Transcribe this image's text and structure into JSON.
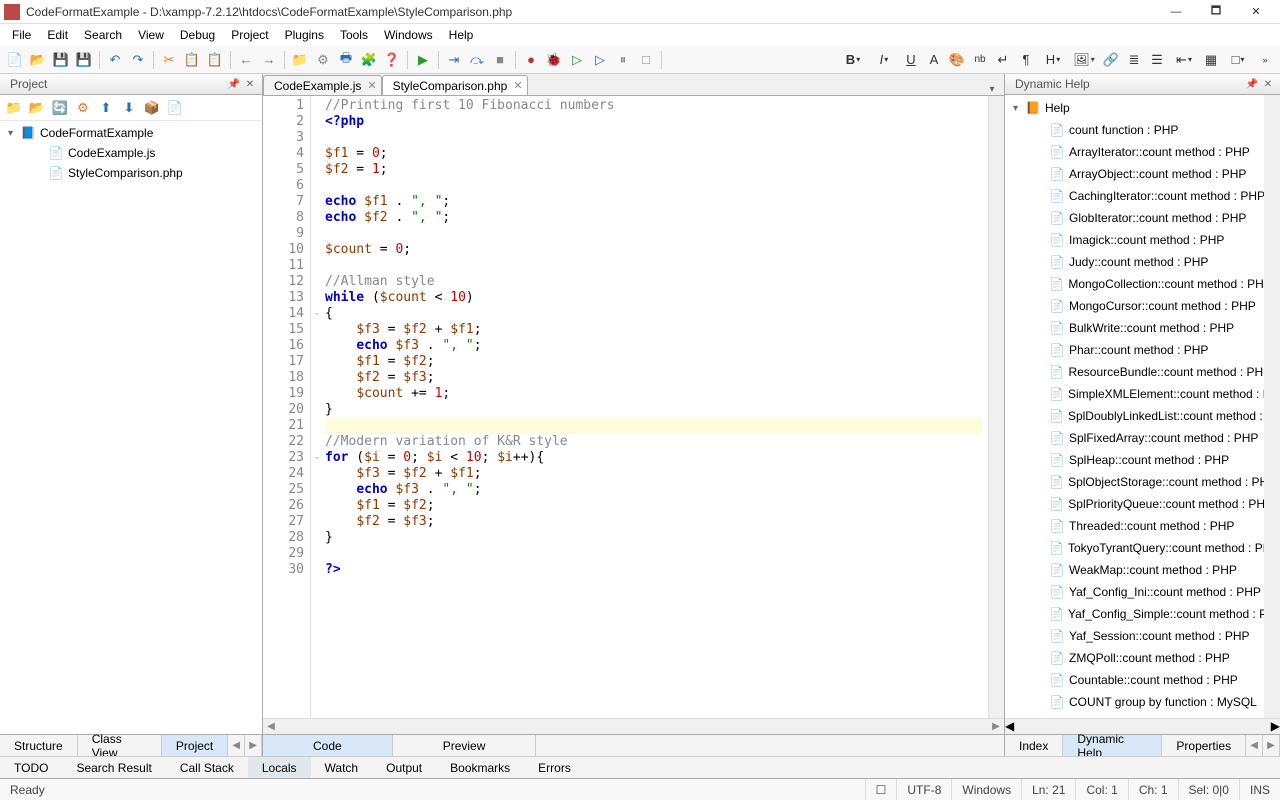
{
  "window": {
    "title": "CodeFormatExample - D:\\xampp-7.2.12\\htdocs\\CodeFormatExample\\StyleComparison.php"
  },
  "menus": [
    "File",
    "Edit",
    "Search",
    "View",
    "Debug",
    "Project",
    "Plugins",
    "Tools",
    "Windows",
    "Help"
  ],
  "project_panel": {
    "title": "Project",
    "tree": {
      "root": "CodeFormatExample",
      "items": [
        "CodeExample.js",
        "StyleComparison.php"
      ]
    },
    "bottom_tabs": [
      "Structure",
      "Class View",
      "Project"
    ],
    "active_bottom_tab": "Project"
  },
  "editor": {
    "tabs": [
      "CodeExample.js",
      "StyleComparison.php"
    ],
    "active_tab": "StyleComparison.php",
    "current_line": 21,
    "total_lines": 30,
    "bottom_tabs": [
      "Code",
      "Preview"
    ],
    "active_bottom_tab": "Code"
  },
  "code_lines": [
    {
      "n": 1,
      "tokens": [
        [
          "cmt",
          "//Printing first 10 Fibonacci numbers"
        ]
      ]
    },
    {
      "n": 2,
      "tokens": [
        [
          "kw",
          "<?php"
        ]
      ]
    },
    {
      "n": 3,
      "tokens": []
    },
    {
      "n": 4,
      "tokens": [
        [
          "var",
          "$f1"
        ],
        [
          "",
          " = "
        ],
        [
          "num",
          "0"
        ],
        [
          "",
          ";"
        ]
      ]
    },
    {
      "n": 5,
      "tokens": [
        [
          "var",
          "$f2"
        ],
        [
          "",
          " = "
        ],
        [
          "num",
          "1"
        ],
        [
          "",
          ";"
        ]
      ]
    },
    {
      "n": 6,
      "tokens": []
    },
    {
      "n": 7,
      "tokens": [
        [
          "kw",
          "echo"
        ],
        [
          "",
          " "
        ],
        [
          "var",
          "$f1"
        ],
        [
          "",
          " . "
        ],
        [
          "str",
          "\", \""
        ],
        [
          "",
          ";"
        ]
      ]
    },
    {
      "n": 8,
      "tokens": [
        [
          "kw",
          "echo"
        ],
        [
          "",
          " "
        ],
        [
          "var",
          "$f2"
        ],
        [
          "",
          " . "
        ],
        [
          "str",
          "\", \""
        ],
        [
          "",
          ";"
        ]
      ]
    },
    {
      "n": 9,
      "tokens": []
    },
    {
      "n": 10,
      "tokens": [
        [
          "var",
          "$count"
        ],
        [
          "",
          " = "
        ],
        [
          "num",
          "0"
        ],
        [
          "",
          ";"
        ]
      ]
    },
    {
      "n": 11,
      "tokens": []
    },
    {
      "n": 12,
      "tokens": [
        [
          "cmt",
          "//Allman style"
        ]
      ]
    },
    {
      "n": 13,
      "tokens": [
        [
          "kw",
          "while"
        ],
        [
          "",
          " ("
        ],
        [
          "var",
          "$count"
        ],
        [
          "",
          " < "
        ],
        [
          "num",
          "10"
        ],
        [
          "",
          ")"
        ]
      ]
    },
    {
      "n": 14,
      "fold": "-",
      "tokens": [
        [
          "",
          "{"
        ]
      ]
    },
    {
      "n": 15,
      "indent": 1,
      "tokens": [
        [
          "var",
          "$f3"
        ],
        [
          "",
          " = "
        ],
        [
          "var",
          "$f2"
        ],
        [
          "",
          " + "
        ],
        [
          "var",
          "$f1"
        ],
        [
          "",
          ";"
        ]
      ]
    },
    {
      "n": 16,
      "indent": 1,
      "tokens": [
        [
          "kw",
          "echo"
        ],
        [
          "",
          " "
        ],
        [
          "var",
          "$f3"
        ],
        [
          "",
          " . "
        ],
        [
          "str",
          "\", \""
        ],
        [
          "",
          ";"
        ]
      ]
    },
    {
      "n": 17,
      "indent": 1,
      "tokens": [
        [
          "var",
          "$f1"
        ],
        [
          "",
          " = "
        ],
        [
          "var",
          "$f2"
        ],
        [
          "",
          ";"
        ]
      ]
    },
    {
      "n": 18,
      "indent": 1,
      "tokens": [
        [
          "var",
          "$f2"
        ],
        [
          "",
          " = "
        ],
        [
          "var",
          "$f3"
        ],
        [
          "",
          ";"
        ]
      ]
    },
    {
      "n": 19,
      "indent": 1,
      "tokens": [
        [
          "var",
          "$count"
        ],
        [
          "",
          " += "
        ],
        [
          "num",
          "1"
        ],
        [
          "",
          ";"
        ]
      ]
    },
    {
      "n": 20,
      "tokens": [
        [
          "",
          "}"
        ]
      ]
    },
    {
      "n": 21,
      "hl": true,
      "tokens": []
    },
    {
      "n": 22,
      "tokens": [
        [
          "cmt",
          "//Modern variation of K&R style"
        ]
      ]
    },
    {
      "n": 23,
      "fold": "-",
      "tokens": [
        [
          "kw",
          "for"
        ],
        [
          "",
          " ("
        ],
        [
          "var",
          "$i"
        ],
        [
          "",
          " = "
        ],
        [
          "num",
          "0"
        ],
        [
          "",
          "; "
        ],
        [
          "var",
          "$i"
        ],
        [
          "",
          " < "
        ],
        [
          "num",
          "10"
        ],
        [
          "",
          "; "
        ],
        [
          "var",
          "$i"
        ],
        [
          "",
          "++){"
        ]
      ]
    },
    {
      "n": 24,
      "indent": 1,
      "tokens": [
        [
          "var",
          "$f3"
        ],
        [
          "",
          " = "
        ],
        [
          "var",
          "$f2"
        ],
        [
          "",
          " + "
        ],
        [
          "var",
          "$f1"
        ],
        [
          "",
          ";"
        ]
      ]
    },
    {
      "n": 25,
      "indent": 1,
      "tokens": [
        [
          "kw",
          "echo"
        ],
        [
          "",
          " "
        ],
        [
          "var",
          "$f3"
        ],
        [
          "",
          " . "
        ],
        [
          "str",
          "\", \""
        ],
        [
          "",
          ";"
        ]
      ]
    },
    {
      "n": 26,
      "indent": 1,
      "tokens": [
        [
          "var",
          "$f1"
        ],
        [
          "",
          " = "
        ],
        [
          "var",
          "$f2"
        ],
        [
          "",
          ";"
        ]
      ]
    },
    {
      "n": 27,
      "indent": 1,
      "tokens": [
        [
          "var",
          "$f2"
        ],
        [
          "",
          " = "
        ],
        [
          "var",
          "$f3"
        ],
        [
          "",
          ";"
        ]
      ]
    },
    {
      "n": 28,
      "tokens": [
        [
          "",
          "}"
        ]
      ]
    },
    {
      "n": 29,
      "tokens": []
    },
    {
      "n": 30,
      "tokens": [
        [
          "kw",
          "?>"
        ]
      ]
    }
  ],
  "help_panel": {
    "title": "Dynamic Help",
    "root": "Help",
    "items": [
      "count function : PHP",
      "ArrayIterator::count method : PHP",
      "ArrayObject::count method : PHP",
      "CachingIterator::count method : PHP",
      "GlobIterator::count method : PHP",
      "Imagick::count method : PHP",
      "Judy::count method : PHP",
      "MongoCollection::count method : PHP",
      "MongoCursor::count method : PHP",
      "BulkWrite::count method : PHP",
      "Phar::count method : PHP",
      "ResourceBundle::count method : PHP",
      "SimpleXMLElement::count method : PHP",
      "SplDoublyLinkedList::count method : PHP",
      "SplFixedArray::count method : PHP",
      "SplHeap::count method : PHP",
      "SplObjectStorage::count method : PHP",
      "SplPriorityQueue::count method : PHP",
      "Threaded::count method : PHP",
      "TokyoTyrantQuery::count method : PHP",
      "WeakMap::count method : PHP",
      "Yaf_Config_Ini::count method : PHP",
      "Yaf_Config_Simple::count method : PHP",
      "Yaf_Session::count method : PHP",
      "ZMQPoll::count method : PHP",
      "Countable::count method : PHP",
      "COUNT group by function : MySQL"
    ],
    "bottom_tabs": [
      "Index",
      "Dynamic Help",
      "Properties"
    ],
    "active_bottom_tab": "Dynamic Help"
  },
  "bottom_view_tabs": [
    "TODO",
    "Search Result",
    "Call Stack",
    "Locals",
    "Watch",
    "Output",
    "Bookmarks",
    "Errors"
  ],
  "bottom_view_active": "Locals",
  "status": {
    "msg": "Ready",
    "encoding": "UTF-8",
    "eol": "Windows",
    "ln": "Ln: 21",
    "col": "Col: 1",
    "ch": "Ch: 1",
    "sel": "Sel: 0|0",
    "mode": "INS"
  }
}
